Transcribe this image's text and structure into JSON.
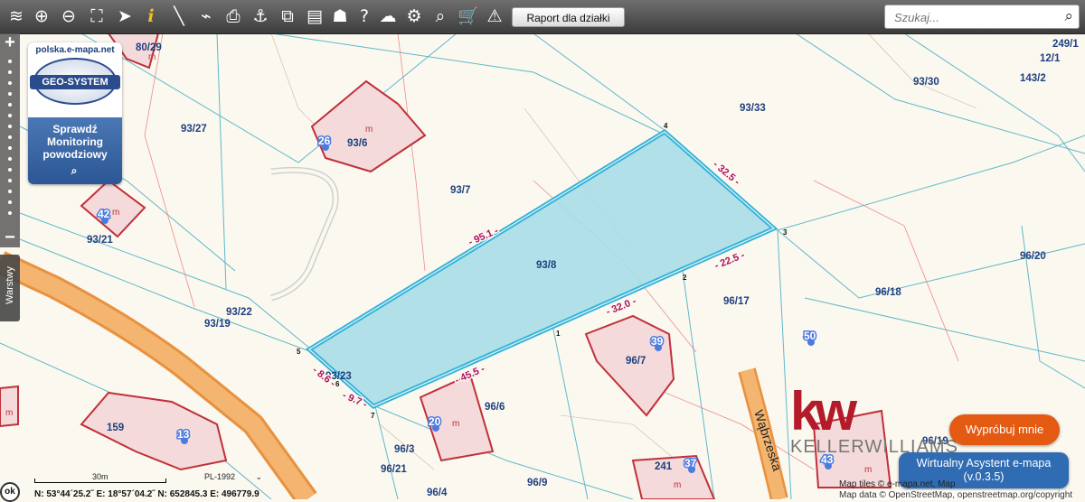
{
  "toolbar": {
    "icons": [
      "layers-icon",
      "zoom-in-icon",
      "zoom-out-icon",
      "full-extent-icon",
      "pointer-icon",
      "info-icon",
      "measure-distance-icon",
      "measure-link-icon",
      "print-icon",
      "anchor-icon",
      "select-parcels-icon",
      "layout-icon",
      "shape-icon",
      "help-icon",
      "cloud-icon",
      "settings-icon",
      "search-map-icon",
      "cart-icon",
      "warning-icon"
    ],
    "report_label": "Raport dla działki",
    "search_placeholder": "Szukaj..."
  },
  "sidebar": {
    "zoom_in": "+",
    "zoom_out": "−",
    "layers_label": "Warstwy"
  },
  "promo": {
    "url": "polska.e-mapa.net",
    "logo": "GEO-SYSTEM",
    "lines": [
      "Sprawdź",
      "Monitoring",
      "powodziowy"
    ]
  },
  "parcels": [
    {
      "id": "80/29"
    },
    {
      "id": "93/27"
    },
    {
      "id": "93/6"
    },
    {
      "id": "93/7"
    },
    {
      "id": "93/33"
    },
    {
      "id": "93/30"
    },
    {
      "id": "249/1"
    },
    {
      "id": "12/1"
    },
    {
      "id": "143/2"
    },
    {
      "id": "93/21"
    },
    {
      "id": "93/8"
    },
    {
      "id": "96/17"
    },
    {
      "id": "96/18"
    },
    {
      "id": "96/20"
    },
    {
      "id": "93/22"
    },
    {
      "id": "93/19"
    },
    {
      "id": "93/23"
    },
    {
      "id": "96/7"
    },
    {
      "id": "96/6"
    },
    {
      "id": "96/3"
    },
    {
      "id": "96/21"
    },
    {
      "id": "96/9"
    },
    {
      "id": "96/4"
    },
    {
      "id": "96/19"
    },
    {
      "id": "159"
    },
    {
      "id": "241"
    }
  ],
  "house_numbers": [
    "26",
    "42",
    "39",
    "50",
    "20",
    "13",
    "37",
    "43"
  ],
  "building_marker": "m",
  "dimensions": [
    "- 95.1 -",
    "- 32.5 -",
    "- 22.5 -",
    "- 32.0 -",
    "- 45.5 -",
    "- 8.6 -",
    "- 9.7 -"
  ],
  "vertices": [
    "1",
    "2",
    "3",
    "4",
    "5",
    "6",
    "7"
  ],
  "street": "Wąbrzeska",
  "branding": {
    "mark": "kw",
    "name": "KELLERWILLIAMS"
  },
  "buttons": {
    "try": "Wypróbuj mnie",
    "assistant": "Wirtualny Asystent e-mapa",
    "assistant_version": "(v.0.3.5)"
  },
  "attribution": {
    "tiles": "Map tiles © e-mapa.net, Map",
    "data": "Map data © OpenStreetMap, openstreetmap.org/copyright"
  },
  "footer": {
    "ok": "ok",
    "scale": "30m",
    "projection": "PL-1992",
    "coords": "N: 53°44´25.2˝  E: 18°57´04.2˝  N: 652845.3  E: 496779.9"
  },
  "colors": {
    "selected_parcel_fill": "#a8dde8",
    "selected_parcel_stroke": "#37b4d8",
    "road": "#f0a050",
    "building": "#c0303a",
    "house_marker": "#4c7be0"
  }
}
